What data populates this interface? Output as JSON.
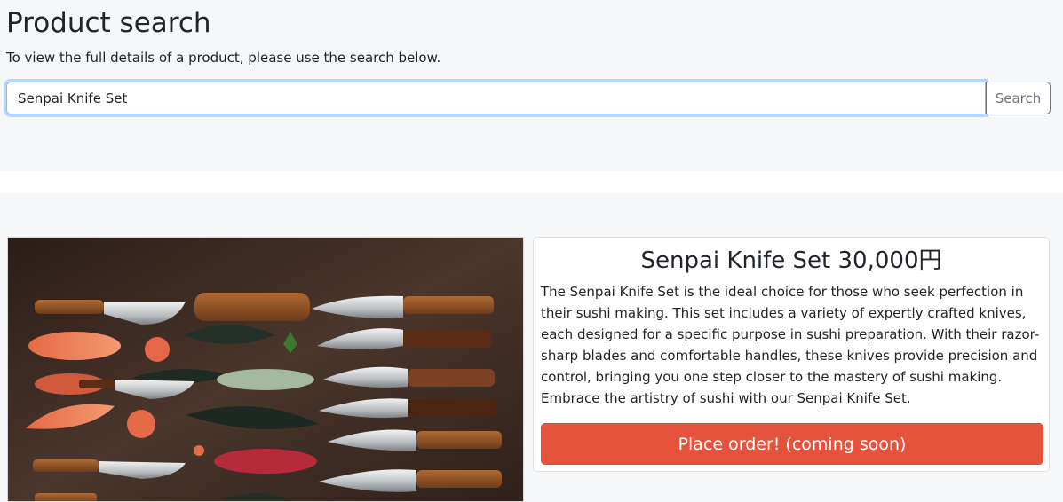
{
  "search_section": {
    "title": "Product search",
    "lead": "To view the full details of a product, please use the search below.",
    "search_value": "Senpai Knife Set",
    "search_button_label": "Search"
  },
  "product": {
    "heading": "Senpai Knife Set 30,000円",
    "description": "The Senpai Knife Set is the ideal choice for those who seek perfection in their sushi making. This set includes a variety of expertly crafted knives, each designed for a specific purpose in sushi preparation. With their razor-sharp blades and comfortable handles, these knives provide precision and control, bringing you one step closer to the mastery of sushi making. Embrace the artistry of sushi with our Senpai Knife Set.",
    "order_button_label": "Place order! (coming soon)",
    "image_alt": "Senpai Knife Set"
  },
  "colors": {
    "band_background": "#f6f7f9",
    "order_button": "#e5533d",
    "input_focus_border": "#86b7fe",
    "search_button_text": "#6c757d"
  }
}
